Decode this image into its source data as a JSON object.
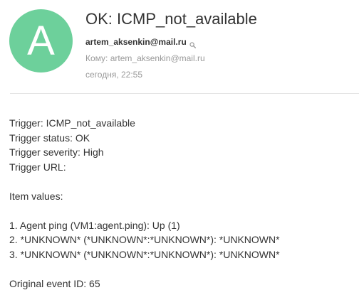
{
  "avatar": {
    "letter": "A",
    "color": "#6dd09b"
  },
  "subject": "OK: ICMP_not_available",
  "sender": {
    "email": "artem_aksenkin@mail.ru",
    "icon": "search-icon"
  },
  "recipient": {
    "label": "Кому:",
    "email": "artem_aksenkin@mail.ru"
  },
  "date": "сегодня, 22:55",
  "body": {
    "trigger": "Trigger: ICMP_not_available",
    "trigger_status": "Trigger status: OK",
    "trigger_severity": "Trigger severity: High",
    "trigger_url": "Trigger URL:",
    "item_values_label": "Item values:",
    "item_1": "1. Agent ping (VM1:agent.ping): Up (1)",
    "item_2": "2. *UNKNOWN* (*UNKNOWN*:*UNKNOWN*): *UNKNOWN*",
    "item_3": "3. *UNKNOWN* (*UNKNOWN*:*UNKNOWN*): *UNKNOWN*",
    "original_event_id": "Original event ID: 65"
  }
}
